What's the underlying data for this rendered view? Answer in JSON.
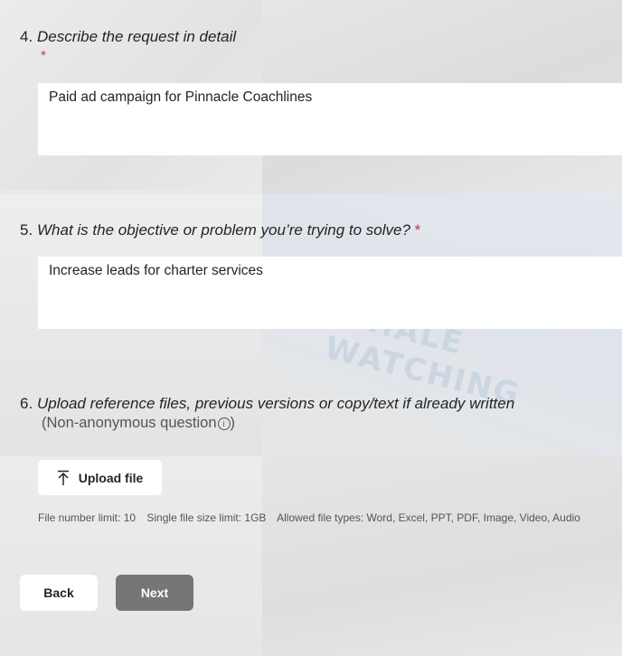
{
  "questions": [
    {
      "number": "4.",
      "text": "Describe the request in detail",
      "required_mark": "*",
      "answer": "Paid ad campaign for Pinnacle Coachlines"
    },
    {
      "number": "5.",
      "text": "What is the objective or problem you’re trying to solve?",
      "required_mark": "*",
      "answer": "Increase leads for charter services"
    },
    {
      "number": "6.",
      "text": "Upload reference files, previous versions or copy/text if already written",
      "note": "(Non-anonymous question",
      "note_close": ")",
      "info_icon": "i"
    }
  ],
  "upload": {
    "button_label": "Upload file",
    "icon": "upload-arrow-icon",
    "limits": {
      "file_number": "File number limit: 10",
      "file_size": "Single file size limit: 1GB",
      "file_types": "Allowed file types: Word, Excel, PPT, PDF, Image, Video, Audio"
    }
  },
  "nav": {
    "back_label": "Back",
    "next_label": "Next"
  },
  "colors": {
    "required": "#c4314b",
    "next_button": "#767676",
    "field_background": "#ffffff"
  },
  "background_text": "WHALE WATCHING"
}
